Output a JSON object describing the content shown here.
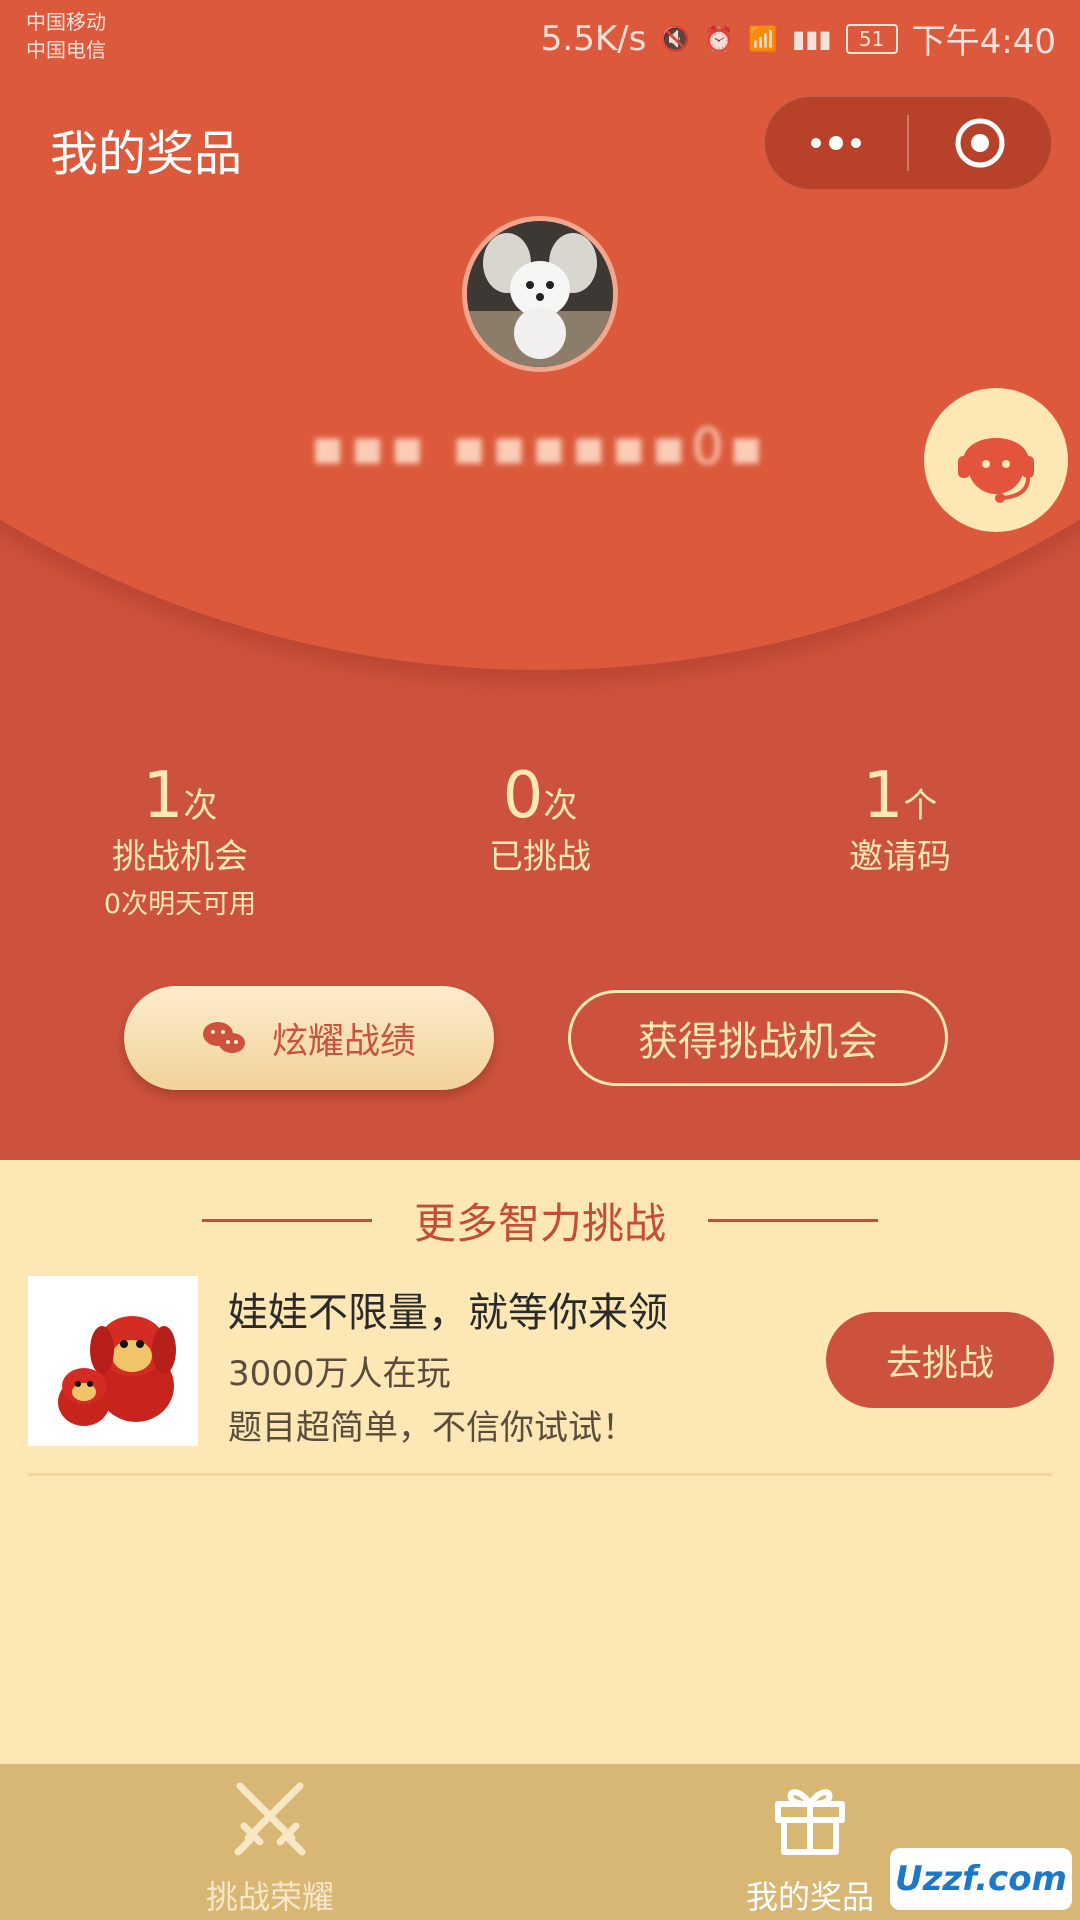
{
  "status_bar": {
    "carrier_1": "中国移动",
    "carrier_2": "中国电信",
    "net_speed": "5.5K/s",
    "battery": "51",
    "time": "下午4:40"
  },
  "nav": {
    "title": "我的奖品"
  },
  "profile": {
    "username": "▪▪▪ ▪▪▪▪▪▪0▪"
  },
  "stats": [
    {
      "value": "1",
      "unit": "次",
      "label": "挑战机会",
      "sub": "0次明天可用"
    },
    {
      "value": "0",
      "unit": "次",
      "label": "已挑战"
    },
    {
      "value": "1",
      "unit": "个",
      "label": "邀请码"
    }
  ],
  "actions": {
    "show_off": "炫耀战绩",
    "get_chance": "获得挑战机会"
  },
  "more_section": {
    "title": "更多智力挑战"
  },
  "card": {
    "title": "娃娃不限量，就等你来领",
    "players": "3000万人在玩",
    "desc": "题目超简单，不信你试试！",
    "button": "去挑战"
  },
  "tabbar": {
    "tabs": [
      {
        "label": "挑战荣耀",
        "icon": "crossed-swords-icon",
        "active": false
      },
      {
        "label": "我的奖品",
        "icon": "gift-icon",
        "active": true
      }
    ]
  },
  "watermark": {
    "text": "Uzzf.com"
  },
  "colors": {
    "primary_red": "#cc523d",
    "header_red": "#dc5a3b",
    "cream": "#fde7b4",
    "tabbar_gold": "#d8b774"
  }
}
